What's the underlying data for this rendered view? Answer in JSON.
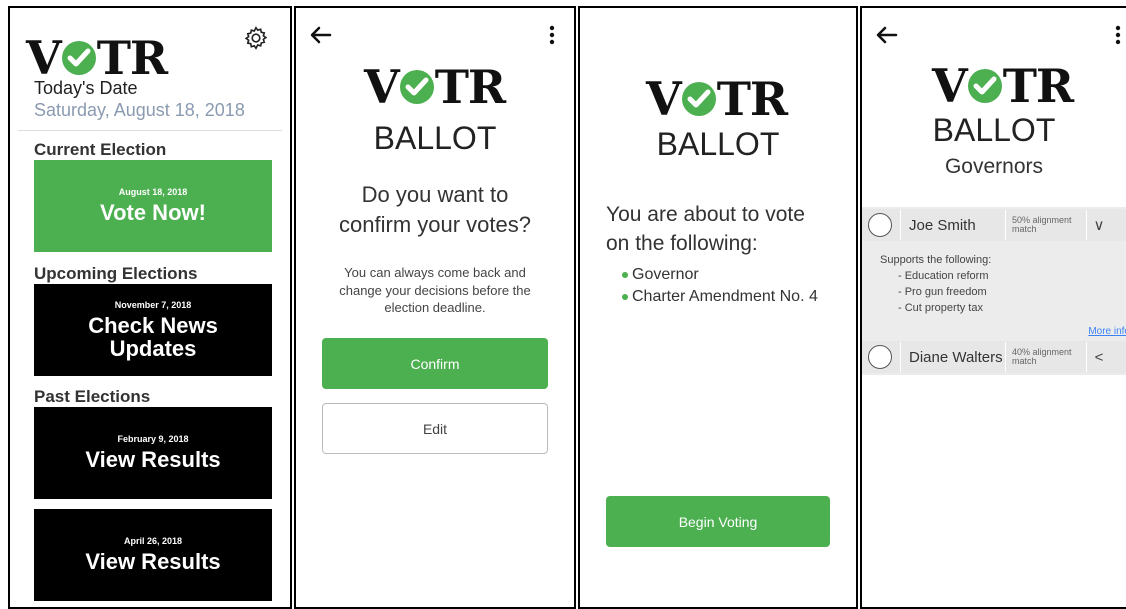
{
  "brand": {
    "name_left": "V",
    "name_right": "TR",
    "check_color": "#4caf50"
  },
  "colors": {
    "accent": "#4caf50",
    "link": "#3b82f6",
    "date_text": "#8a9ab0"
  },
  "home": {
    "settings_icon": "gear-icon",
    "today_label": "Today's Date",
    "today_date": "Saturday, August 18, 2018",
    "current_heading": "Current Election",
    "current_card": {
      "date": "August 18, 2018",
      "action": "Vote Now!"
    },
    "upcoming_heading": "Upcoming Elections",
    "upcoming_card": {
      "date": "November 7, 2018",
      "action_line1": "Check News",
      "action_line2": "Updates"
    },
    "past_heading": "Past Elections",
    "past_cards": [
      {
        "date": "February 9, 2018",
        "action": "View Results"
      },
      {
        "date": "April 26, 2018",
        "action": "View Results"
      }
    ]
  },
  "confirm": {
    "back_icon": "arrow-left-icon",
    "menu_icon": "more-vertical-icon",
    "ballot_word": "BALLOT",
    "question_line1": "Do you want to",
    "question_line2": "confirm your votes?",
    "sub_line1": "You can always come back and",
    "sub_line2": "change your decisions before the",
    "sub_line3": "election deadline.",
    "confirm_label": "Confirm",
    "edit_label": "Edit"
  },
  "intro": {
    "ballot_word": "BALLOT",
    "intro_line1": "You are about to vote",
    "intro_line2": "on the following:",
    "items": [
      "Governor",
      "Charter Amendment No. 4"
    ],
    "begin_label": "Begin Voting"
  },
  "race": {
    "back_icon": "arrow-left-icon",
    "menu_icon": "more-vertical-icon",
    "ballot_word": "BALLOT",
    "category": "Governors",
    "candidates": [
      {
        "name": "Joe Smith",
        "alignment_line1": "50% alignment",
        "alignment_line2": "match",
        "chevron": "∨",
        "details_heading": "Supports the following:",
        "details": [
          "- Education reform",
          "- Pro gun freedom",
          "- Cut property tax"
        ],
        "more_link": "More info"
      },
      {
        "name": "Diane Walters",
        "alignment_line1": "40% alignment",
        "alignment_line2": "match",
        "chevron": "<"
      }
    ]
  }
}
